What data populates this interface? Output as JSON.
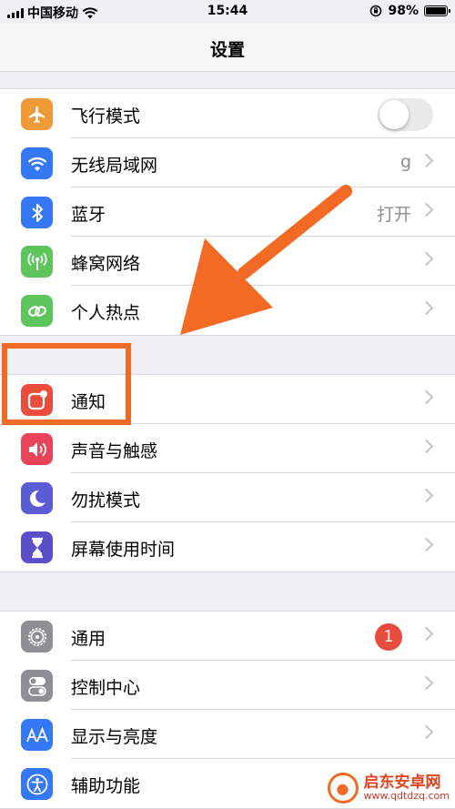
{
  "status_bar": {
    "carrier": "中国移动",
    "time": "15:44",
    "battery": "98%",
    "battery_level": 0.98
  },
  "nav": {
    "title": "设置"
  },
  "groups": [
    {
      "items": [
        {
          "label": "飞行模式",
          "icon": "airplane-icon",
          "color": "#f19a38",
          "accessory": "toggle",
          "toggle_on": false
        },
        {
          "label": "无线局域网",
          "icon": "wifi-icon",
          "color": "#3478f6",
          "accessory": "value",
          "value": "g"
        },
        {
          "label": "蓝牙",
          "icon": "bluetooth-icon",
          "color": "#3478f6",
          "accessory": "value",
          "value": "打开"
        },
        {
          "label": "蜂窝网络",
          "icon": "antenna-icon",
          "color": "#5ec55d",
          "accessory": "chevron"
        },
        {
          "label": "个人热点",
          "icon": "hotspot-chain-icon",
          "color": "#5ec55d",
          "accessory": "chevron"
        }
      ]
    },
    {
      "items": [
        {
          "label": "通知",
          "icon": "notification-icon",
          "color": "#eb4d3d",
          "accessory": "chevron"
        },
        {
          "label": "声音与触感",
          "icon": "speaker-icon",
          "color": "#e9445a",
          "accessory": "chevron"
        },
        {
          "label": "勿扰模式",
          "icon": "moon-icon",
          "color": "#5b5bd6",
          "accessory": "chevron"
        },
        {
          "label": "屏幕使用时间",
          "icon": "hourglass-icon",
          "color": "#5b4fc9",
          "accessory": "chevron"
        }
      ]
    },
    {
      "items": [
        {
          "label": "通用",
          "icon": "gear-icon",
          "color": "#8e8e93",
          "accessory": "badge",
          "badge": "1"
        },
        {
          "label": "控制中心",
          "icon": "switches-icon",
          "color": "#8e8e93",
          "accessory": "chevron"
        },
        {
          "label": "显示与亮度",
          "icon": "text-size-icon",
          "color": "#3478f6",
          "accessory": "chevron"
        },
        {
          "label": "辅助功能",
          "icon": "accessibility-icon",
          "color": "#3478f6",
          "accessory": "chevron"
        }
      ]
    }
  ],
  "annotation": {
    "color": "#f26a24"
  },
  "watermark": {
    "title": "启东安卓网",
    "url": "www.qdtdzq.com"
  }
}
